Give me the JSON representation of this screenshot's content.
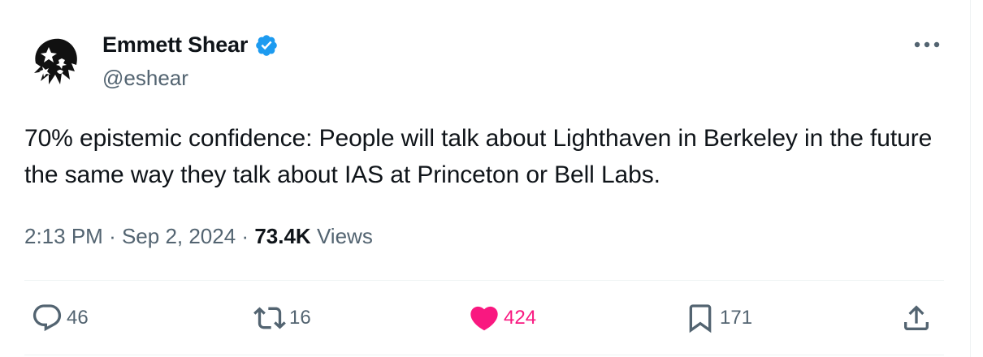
{
  "author": {
    "display_name": "Emmett Shear",
    "handle": "@eshear",
    "verified": true,
    "verified_color": "#1d9bf0"
  },
  "tweet": {
    "text": "70% epistemic confidence: People will talk about Lighthaven in Berkeley in the future the same way they talk about IAS at Princeton or Bell Labs.",
    "time": "2:13 PM",
    "separator": "·",
    "date": "Sep 2, 2024",
    "views_count": "73.4K",
    "views_label": "Views"
  },
  "actions": {
    "replies": "46",
    "reposts": "16",
    "likes": "424",
    "bookmarks": "171"
  },
  "colors": {
    "like": "#f91880",
    "secondary_text": "#536471",
    "primary_text": "#0f1419"
  }
}
